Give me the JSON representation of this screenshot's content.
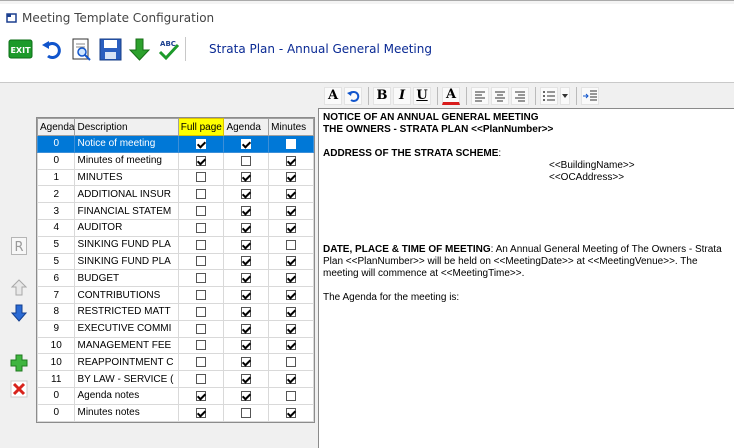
{
  "window": {
    "title": "Meeting Template Configuration"
  },
  "toolbar": {
    "title": "Strata Plan - Annual General Meeting",
    "exit_label": "EXIT",
    "spell_label": "ABC"
  },
  "format_bar": {
    "font_label": "A",
    "bold_label": "B",
    "italic_label": "I",
    "underline_label": "U",
    "color_label": "A"
  },
  "grid": {
    "columns": [
      "Agenda",
      "Description",
      "Full page",
      "Agenda",
      "Minutes"
    ],
    "rows": [
      {
        "agenda": "0",
        "description": "Notice of meeting",
        "full_page": true,
        "agenda_chk": true,
        "minutes": false,
        "selected": true
      },
      {
        "agenda": "0",
        "description": "Minutes of meeting",
        "full_page": true,
        "agenda_chk": false,
        "minutes": true
      },
      {
        "agenda": "1",
        "description": "MINUTES",
        "full_page": false,
        "agenda_chk": true,
        "minutes": true
      },
      {
        "agenda": "2",
        "description": "ADDITIONAL INSUR",
        "full_page": false,
        "agenda_chk": true,
        "minutes": true
      },
      {
        "agenda": "3",
        "description": "FINANCIAL STATEM",
        "full_page": false,
        "agenda_chk": true,
        "minutes": true
      },
      {
        "agenda": "4",
        "description": "AUDITOR",
        "full_page": false,
        "agenda_chk": true,
        "minutes": true
      },
      {
        "agenda": "5",
        "description": "SINKING FUND PLA",
        "full_page": false,
        "agenda_chk": true,
        "minutes": false
      },
      {
        "agenda": "5",
        "description": "SINKING FUND PLA",
        "full_page": false,
        "agenda_chk": true,
        "minutes": true
      },
      {
        "agenda": "6",
        "description": "BUDGET",
        "full_page": false,
        "agenda_chk": true,
        "minutes": true
      },
      {
        "agenda": "7",
        "description": "CONTRIBUTIONS",
        "full_page": false,
        "agenda_chk": true,
        "minutes": true
      },
      {
        "agenda": "8",
        "description": "RESTRICTED MATT",
        "full_page": false,
        "agenda_chk": true,
        "minutes": true
      },
      {
        "agenda": "9",
        "description": "EXECUTIVE COMMI",
        "full_page": false,
        "agenda_chk": true,
        "minutes": true
      },
      {
        "agenda": "10",
        "description": "MANAGEMENT FEE",
        "full_page": false,
        "agenda_chk": true,
        "minutes": true
      },
      {
        "agenda": "10",
        "description": "REAPPOINTMENT C",
        "full_page": false,
        "agenda_chk": true,
        "minutes": false
      },
      {
        "agenda": "11",
        "description": "BY LAW - SERVICE (",
        "full_page": false,
        "agenda_chk": true,
        "minutes": true
      },
      {
        "agenda": "0",
        "description": "Agenda notes",
        "full_page": true,
        "agenda_chk": true,
        "minutes": false
      },
      {
        "agenda": "0",
        "description": "Minutes notes",
        "full_page": true,
        "agenda_chk": false,
        "minutes": true
      }
    ]
  },
  "editor": {
    "line1": "NOTICE OF AN ANNUAL GENERAL MEETING",
    "line2": "THE OWNERS - STRATA PLAN <<PlanNumber>>",
    "address_heading": "ADDRESS OF THE STRATA SCHEME",
    "address_colon": ":",
    "building": "<<BuildingName>>",
    "oc_address": "<<OCAddress>>",
    "date_heading": "DATE, PLACE & TIME OF MEETING",
    "date_text": ": An Annual General Meeting of The Owners - Strata Plan <<PlanNumber>> will be held on <<MeetingDate>> at <<MeetingVenue>>. The meeting will commence at <<MeetingTime>>.",
    "agenda_line": "The Agenda for the meeting is:"
  },
  "side": {
    "r_label": "R"
  },
  "colors": {
    "accent": "#0078d7",
    "title_blue": "#0a2a94",
    "highlight": "#ffff00"
  }
}
